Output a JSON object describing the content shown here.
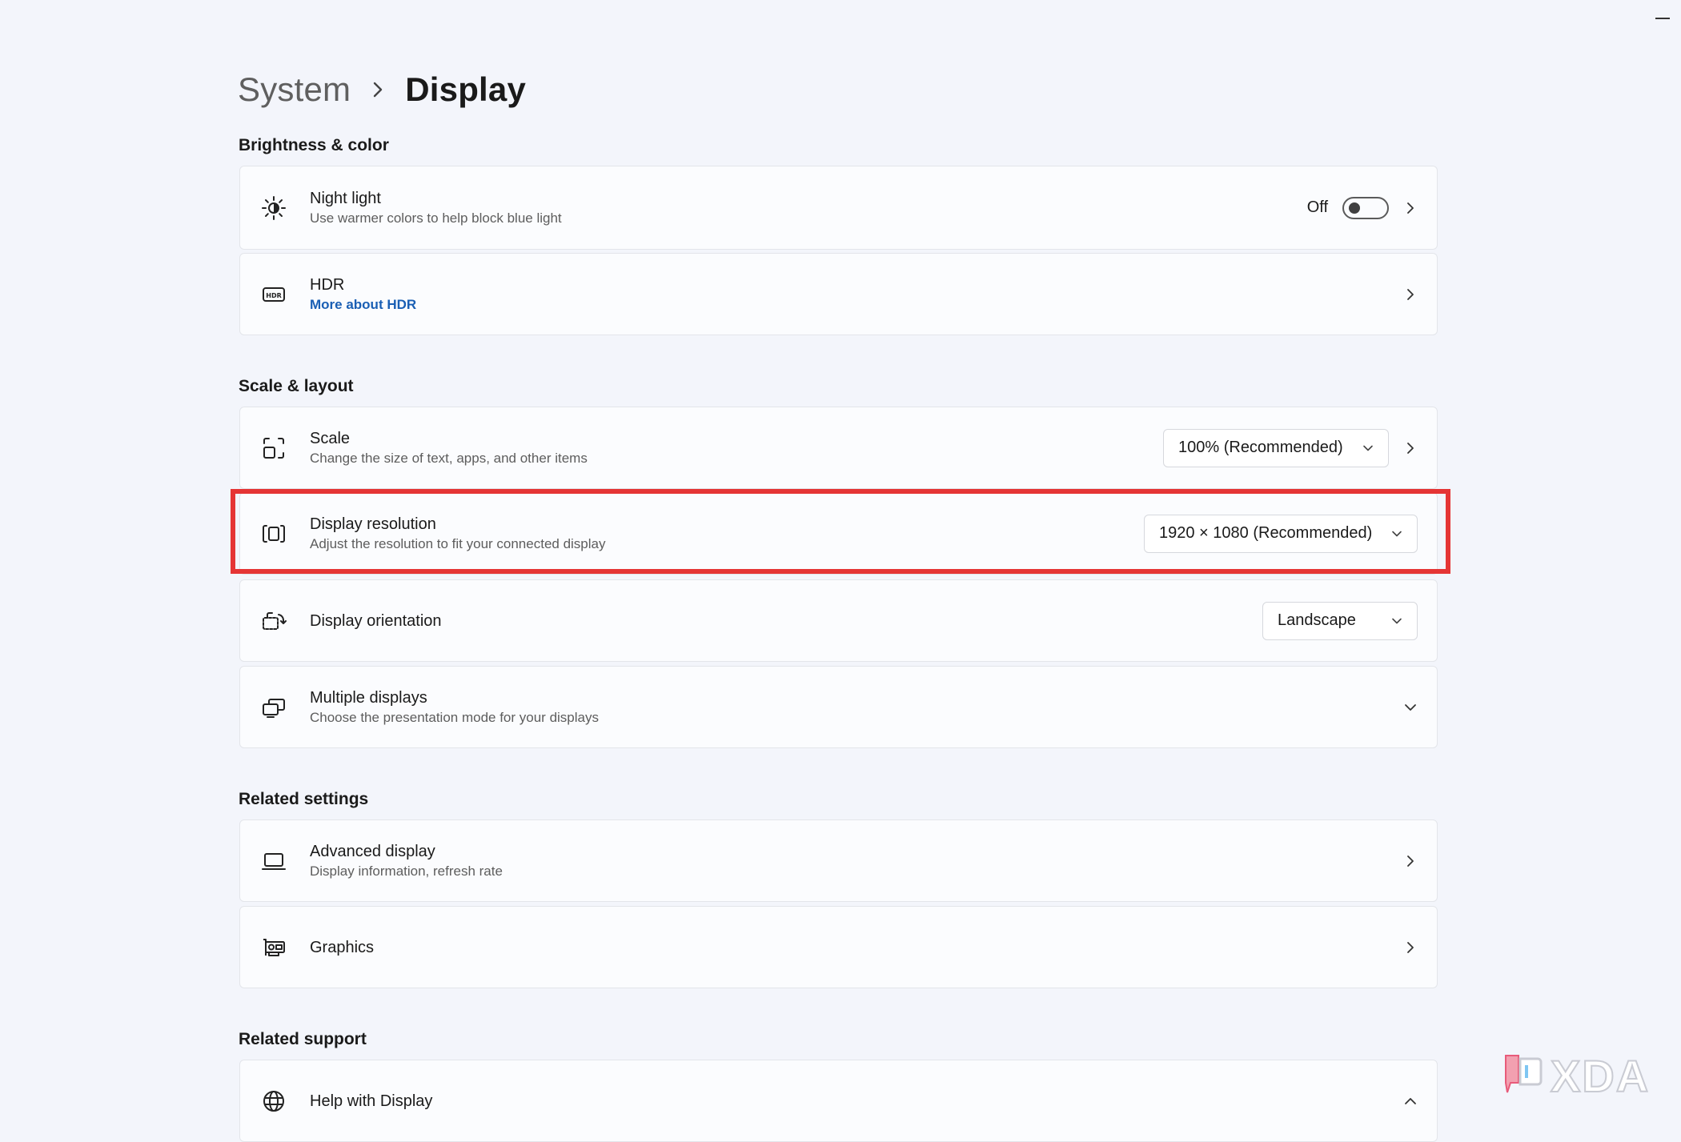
{
  "breadcrumb": {
    "parent": "System",
    "current": "Display"
  },
  "sections": {
    "brightness": "Brightness & color",
    "scale_layout": "Scale & layout",
    "related_settings": "Related settings",
    "related_support": "Related support"
  },
  "night_light": {
    "title": "Night light",
    "subtitle": "Use warmer colors to help block blue light",
    "state_label": "Off",
    "enabled": false
  },
  "hdr": {
    "title": "HDR",
    "link": "More about HDR"
  },
  "scale": {
    "title": "Scale",
    "subtitle": "Change the size of text, apps, and other items",
    "value": "100% (Recommended)"
  },
  "resolution": {
    "title": "Display resolution",
    "subtitle": "Adjust the resolution to fit your connected display",
    "value": "1920 × 1080 (Recommended)"
  },
  "orientation": {
    "title": "Display orientation",
    "value": "Landscape"
  },
  "multiple_displays": {
    "title": "Multiple displays",
    "subtitle": "Choose the presentation mode for your displays"
  },
  "advanced_display": {
    "title": "Advanced display",
    "subtitle": "Display information, refresh rate"
  },
  "graphics": {
    "title": "Graphics"
  },
  "help": {
    "title": "Help with Display"
  },
  "watermark": {
    "text": "XDA"
  },
  "colors": {
    "highlight": "#e53535",
    "link": "#1a5fb4",
    "background": "#f3f5fb"
  },
  "icons": {
    "night_light": "sun-icon",
    "hdr": "hdr-icon",
    "scale": "scale-icon",
    "resolution": "resolution-icon",
    "orientation": "orientation-icon",
    "multiple_displays": "multiple-displays-icon",
    "advanced_display": "laptop-icon",
    "graphics": "graphics-card-icon",
    "help": "globe-icon"
  }
}
